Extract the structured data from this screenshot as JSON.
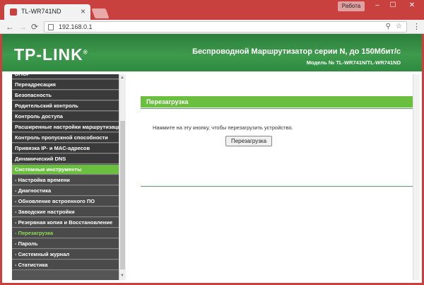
{
  "browser": {
    "tab_title": "TL-WR741ND",
    "tab_close": "×",
    "work_label": "Работа",
    "url": "192.168.0.1",
    "window_controls": {
      "minimize": "–",
      "maximize": "☐",
      "close": "✕"
    },
    "nav": {
      "back": "←",
      "forward": "→",
      "reload": "C"
    },
    "icons": {
      "key": "key-icon",
      "star": "star-icon",
      "menu": "menu-icon"
    }
  },
  "banner": {
    "logo": "TP-LINK",
    "logo_mark": "®",
    "title": "Беспроводной Маршрутизатор серии N, до 150Мбит/с",
    "model": "Модель № TL-WR741N/TL-WR741ND"
  },
  "sidebar": {
    "items": [
      {
        "label": "DHCP"
      },
      {
        "label": "Переадресация"
      },
      {
        "label": "Безопасность"
      },
      {
        "label": "Родительский контроль"
      },
      {
        "label": "Контроль доступа"
      },
      {
        "label": "Расширенные настройки маршрутизации"
      },
      {
        "label": "Контроль пропускной способности"
      },
      {
        "label": "Привязка IP- и MAC-адресов"
      },
      {
        "label": "Динамический DNS"
      },
      {
        "label": "Системные инструменты"
      },
      {
        "label": "- Настройка времени"
      },
      {
        "label": "- Диагностика"
      },
      {
        "label": "- Обновление встроенного ПО"
      },
      {
        "label": "- Заводские настройки"
      },
      {
        "label": "- Резервная копия и Восстановление"
      },
      {
        "label": "- Перезагрузка"
      },
      {
        "label": "- Пароль"
      },
      {
        "label": "- Системный журнал"
      },
      {
        "label": "- Статистика"
      }
    ]
  },
  "main": {
    "section_title": "Перезагрузка",
    "instruction": "Нажмите на эту кнопку, чтобы перезагрузить устройство.",
    "reboot_button": "Перезагрузка"
  },
  "colors": {
    "chrome_red": "#c8413f",
    "banner_green": "#2e8a3e",
    "accent_green": "#6abf3f",
    "sidebar_dark": "#3a3a3a"
  }
}
